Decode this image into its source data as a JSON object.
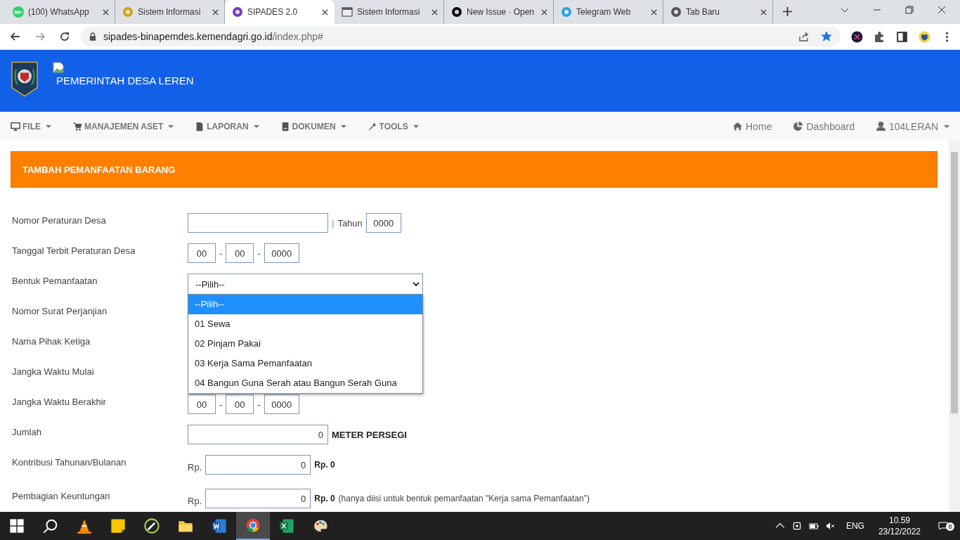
{
  "browser": {
    "tabs": [
      {
        "title": "(100) WhatsApp",
        "selected": false
      },
      {
        "title": "Sistem Informasi",
        "selected": false
      },
      {
        "title": "SIPADES 2.0",
        "selected": true
      },
      {
        "title": "Sistem Informasi",
        "selected": false
      },
      {
        "title": "New Issue · Open",
        "selected": false
      },
      {
        "title": "Telegram Web",
        "selected": false
      },
      {
        "title": "Tab Baru",
        "selected": false
      }
    ],
    "whatsapp_badge": "99+",
    "url": {
      "host": "sipades-binapemdes.kemendagri.go.id",
      "path": "/index.php#"
    },
    "bookmarked": true
  },
  "header": {
    "title": "PEMERINTAH DESA LEREN"
  },
  "menu": [
    {
      "label": "FILE"
    },
    {
      "label": "MANAJEMEN ASET"
    },
    {
      "label": "LAPORAN"
    },
    {
      "label": "DOKUMEN"
    },
    {
      "label": "TOOLS"
    }
  ],
  "nav_right": [
    {
      "label": "Home",
      "kind": "home"
    },
    {
      "label": "Dashboard",
      "kind": "dashboard"
    },
    {
      "label": "104LERAN",
      "kind": "user"
    }
  ],
  "panel": {
    "title": "TAMBAH PEMANFAATAN BARANG"
  },
  "form": [
    {
      "kind": "number_year",
      "label": "Nomor Peraturan Desa",
      "separator": "|",
      "year_label": "Tahun",
      "year": "0000"
    },
    {
      "kind": "date",
      "label": "Tanggal Terbit Peraturan Desa",
      "day": "00",
      "month": "00",
      "year": "0000",
      "separator": "-"
    },
    {
      "kind": "select",
      "label": "Bentuk Pemanfaatan",
      "value": "--Pilih--",
      "options": [
        {
          "label": "--Pilih--",
          "selected": true
        },
        {
          "label": "01 Sewa",
          "selected": false
        },
        {
          "label": "02 Pinjam Pakai",
          "selected": false
        },
        {
          "label": "03 Kerja Sama Pemanfaatan",
          "selected": false
        },
        {
          "label": "04 Bangun Guna Serah atau Bangun Serah Guna",
          "selected": false
        }
      ]
    },
    {
      "kind": "covered",
      "label": "Nomor Surat Perjanjian"
    },
    {
      "kind": "covered",
      "label": "Nama Pihak Ketiga"
    },
    {
      "kind": "covered",
      "label": "Jangka Waktu Mulai"
    },
    {
      "kind": "date",
      "label": "Jangka Waktu Berakhir",
      "day": "00",
      "month": "00",
      "year": "0000",
      "separator": "-"
    },
    {
      "kind": "number_unit",
      "label": "Jumlah",
      "value": "0",
      "unit": "METER PERSEGI"
    },
    {
      "kind": "money",
      "label": "Kontribusi Tahunan/Bulanan",
      "prefix": "Rp.",
      "value": "0",
      "total": "Rp. 0"
    },
    {
      "kind": "money",
      "label": "Pembagian Keuntungan",
      "prefix": "Rp.",
      "value": "0",
      "total": "Rp. 0",
      "note": "(hanya diisi untuk bentuk pemanfaatan \"Kerja sama Pemanfaatan\")"
    }
  ],
  "taskbar": {
    "language": "ENG",
    "time": "10.59",
    "date": "23/12/2022",
    "notifications": "8"
  }
}
